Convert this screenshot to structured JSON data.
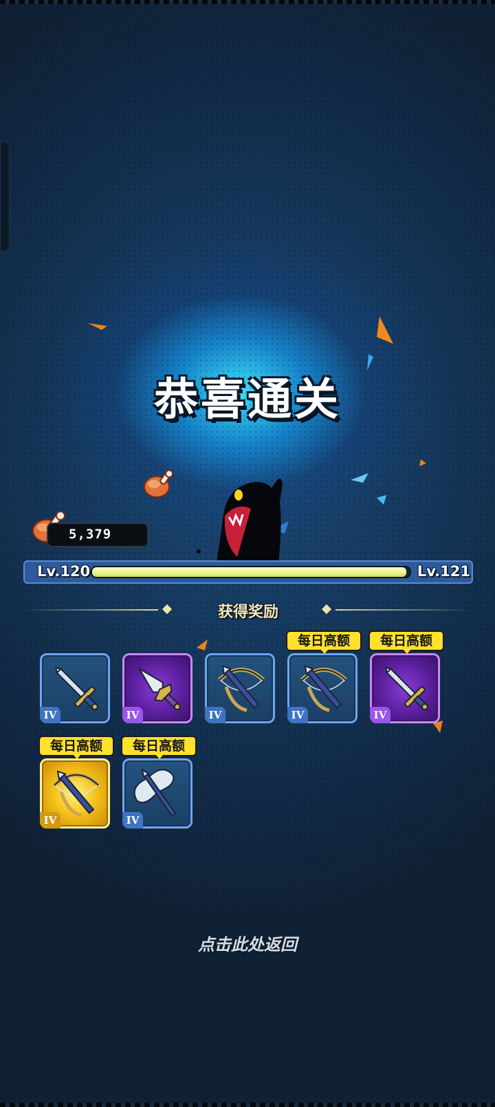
{
  "stage_clear": {
    "title": "恭喜通关"
  },
  "resources": {
    "meat": {
      "icon": "meat-icon",
      "value": "5,379"
    }
  },
  "level": {
    "current": "Lv.120",
    "next": "Lv.121",
    "progress": 0.99
  },
  "rewards": {
    "title": "获得奖励",
    "items": [
      {
        "weapon": "sword",
        "rarity": "blue",
        "tier": "IV",
        "badge": ""
      },
      {
        "weapon": "dagger",
        "rarity": "purple",
        "tier": "IV",
        "badge": ""
      },
      {
        "weapon": "crossbow",
        "rarity": "blue",
        "tier": "IV",
        "badge": ""
      },
      {
        "weapon": "crossbow",
        "rarity": "blue",
        "tier": "IV",
        "badge": "每日高额"
      },
      {
        "weapon": "sword",
        "rarity": "purple",
        "tier": "IV",
        "badge": "每日高额"
      },
      {
        "weapon": "crossbow",
        "rarity": "gold",
        "tier": "IV",
        "badge": "每日高额"
      },
      {
        "weapon": "axe",
        "rarity": "blue",
        "tier": "IV",
        "badge": "每日高额"
      }
    ]
  },
  "footer": {
    "return_label": "点击此处返回"
  },
  "colors": {
    "glow": "#3ce6ff",
    "bar_fill": "#e8f58a",
    "badge": "#ffe12e",
    "purple": "#8a3bd6",
    "gold": "#f6c21a"
  }
}
